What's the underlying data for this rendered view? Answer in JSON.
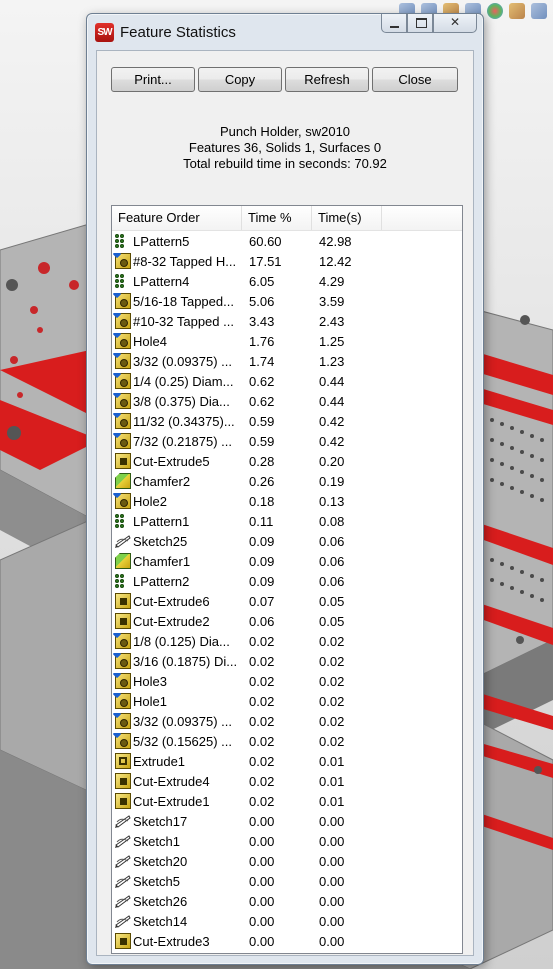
{
  "window": {
    "title": "Feature Statistics",
    "app_icon_text": "SW"
  },
  "toolbar": {
    "print_label": "Print...",
    "copy_label": "Copy",
    "refresh_label": "Refresh",
    "close_label": "Close"
  },
  "summary": {
    "line1": "Punch Holder, sw2010",
    "line2": "Features 36, Solids 1, Surfaces 0",
    "line3": "Total rebuild time in seconds: 70.92"
  },
  "table": {
    "headers": [
      "Feature Order",
      "Time %",
      "Time(s)"
    ],
    "rows": [
      {
        "icon": "pattern",
        "name": "LPattern5",
        "pct": "60.60",
        "time": "42.98"
      },
      {
        "icon": "hole",
        "name": "#8-32 Tapped H...",
        "pct": "17.51",
        "time": "12.42"
      },
      {
        "icon": "pattern",
        "name": "LPattern4",
        "pct": "6.05",
        "time": "4.29"
      },
      {
        "icon": "hole",
        "name": "5/16-18 Tapped...",
        "pct": "5.06",
        "time": "3.59"
      },
      {
        "icon": "hole",
        "name": "#10-32 Tapped ...",
        "pct": "3.43",
        "time": "2.43"
      },
      {
        "icon": "hole",
        "name": "Hole4",
        "pct": "1.76",
        "time": "1.25"
      },
      {
        "icon": "hole",
        "name": "3/32 (0.09375) ...",
        "pct": "1.74",
        "time": "1.23"
      },
      {
        "icon": "hole",
        "name": "1/4 (0.25) Diam...",
        "pct": "0.62",
        "time": "0.44"
      },
      {
        "icon": "hole",
        "name": "3/8 (0.375) Dia...",
        "pct": "0.62",
        "time": "0.44"
      },
      {
        "icon": "hole",
        "name": "11/32 (0.34375)...",
        "pct": "0.59",
        "time": "0.42"
      },
      {
        "icon": "hole",
        "name": "7/32 (0.21875) ...",
        "pct": "0.59",
        "time": "0.42"
      },
      {
        "icon": "cut",
        "name": "Cut-Extrude5",
        "pct": "0.28",
        "time": "0.20"
      },
      {
        "icon": "chamfer",
        "name": "Chamfer2",
        "pct": "0.26",
        "time": "0.19"
      },
      {
        "icon": "hole",
        "name": "Hole2",
        "pct": "0.18",
        "time": "0.13"
      },
      {
        "icon": "pattern",
        "name": "LPattern1",
        "pct": "0.11",
        "time": "0.08"
      },
      {
        "icon": "sketch",
        "name": "Sketch25",
        "pct": "0.09",
        "time": "0.06"
      },
      {
        "icon": "chamfer",
        "name": "Chamfer1",
        "pct": "0.09",
        "time": "0.06"
      },
      {
        "icon": "pattern",
        "name": "LPattern2",
        "pct": "0.09",
        "time": "0.06"
      },
      {
        "icon": "cut",
        "name": "Cut-Extrude6",
        "pct": "0.07",
        "time": "0.05"
      },
      {
        "icon": "cut",
        "name": "Cut-Extrude2",
        "pct": "0.06",
        "time": "0.05"
      },
      {
        "icon": "hole",
        "name": "1/8 (0.125) Dia...",
        "pct": "0.02",
        "time": "0.02"
      },
      {
        "icon": "hole",
        "name": "3/16 (0.1875) Di...",
        "pct": "0.02",
        "time": "0.02"
      },
      {
        "icon": "hole",
        "name": "Hole3",
        "pct": "0.02",
        "time": "0.02"
      },
      {
        "icon": "hole",
        "name": "Hole1",
        "pct": "0.02",
        "time": "0.02"
      },
      {
        "icon": "hole",
        "name": "3/32 (0.09375) ...",
        "pct": "0.02",
        "time": "0.02"
      },
      {
        "icon": "hole",
        "name": "5/32 (0.15625) ...",
        "pct": "0.02",
        "time": "0.02"
      },
      {
        "icon": "extrude",
        "name": "Extrude1",
        "pct": "0.02",
        "time": "0.01"
      },
      {
        "icon": "cut",
        "name": "Cut-Extrude4",
        "pct": "0.02",
        "time": "0.01"
      },
      {
        "icon": "cut",
        "name": "Cut-Extrude1",
        "pct": "0.02",
        "time": "0.01"
      },
      {
        "icon": "sketch",
        "name": "Sketch17",
        "pct": "0.00",
        "time": "0.00"
      },
      {
        "icon": "sketch",
        "name": "Sketch1",
        "pct": "0.00",
        "time": "0.00"
      },
      {
        "icon": "sketch",
        "name": "Sketch20",
        "pct": "0.00",
        "time": "0.00"
      },
      {
        "icon": "sketch",
        "name": "Sketch5",
        "pct": "0.00",
        "time": "0.00"
      },
      {
        "icon": "sketch",
        "name": "Sketch26",
        "pct": "0.00",
        "time": "0.00"
      },
      {
        "icon": "sketch",
        "name": "Sketch14",
        "pct": "0.00",
        "time": "0.00"
      },
      {
        "icon": "cut",
        "name": "Cut-Extrude3",
        "pct": "0.00",
        "time": "0.00"
      }
    ]
  },
  "colors": {
    "dialog_frame": "#dfe6ee",
    "model_red": "#d81d1d",
    "model_grey": "#9a9a9a"
  }
}
